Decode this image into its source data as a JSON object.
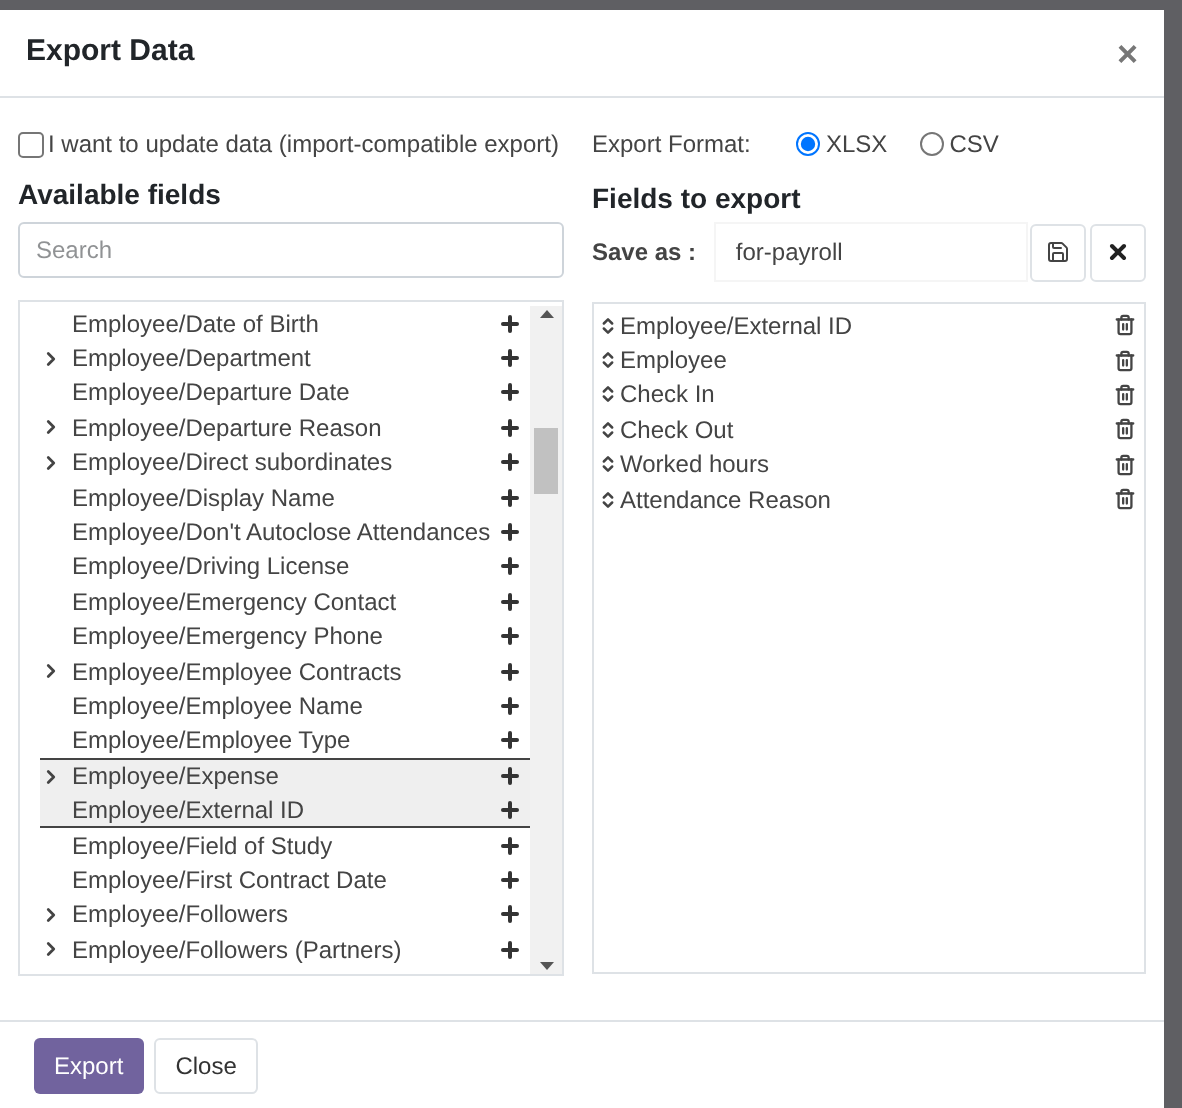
{
  "dialog": {
    "title": "Export Data",
    "close": "×"
  },
  "import_compatible": {
    "label": "I want to update data (import-compatible export)",
    "checked": false
  },
  "export_format": {
    "label": "Export Format:",
    "options": [
      {
        "label": "XLSX",
        "selected": true
      },
      {
        "label": "CSV",
        "selected": false
      }
    ]
  },
  "available_fields": {
    "title": "Available fields",
    "search": {
      "placeholder": "Search"
    },
    "items": [
      {
        "label": "Employee/Date of Birth",
        "expandable": false,
        "selected": false
      },
      {
        "label": "Employee/Department",
        "expandable": true,
        "selected": false
      },
      {
        "label": "Employee/Departure Date",
        "expandable": false,
        "selected": false
      },
      {
        "label": "Employee/Departure Reason",
        "expandable": true,
        "selected": false
      },
      {
        "label": "Employee/Direct subordinates",
        "expandable": true,
        "selected": false
      },
      {
        "label": "Employee/Display Name",
        "expandable": false,
        "selected": false
      },
      {
        "label": "Employee/Don't Autoclose Attendances",
        "expandable": false,
        "selected": false
      },
      {
        "label": "Employee/Driving License",
        "expandable": false,
        "selected": false
      },
      {
        "label": "Employee/Emergency Contact",
        "expandable": false,
        "selected": false
      },
      {
        "label": "Employee/Emergency Phone",
        "expandable": false,
        "selected": false
      },
      {
        "label": "Employee/Employee Contracts",
        "expandable": true,
        "selected": false
      },
      {
        "label": "Employee/Employee Name",
        "expandable": false,
        "selected": false
      },
      {
        "label": "Employee/Employee Type",
        "expandable": false,
        "selected": false
      },
      {
        "label": "Employee/Expense",
        "expandable": true,
        "selected": true
      },
      {
        "label": "Employee/External ID",
        "expandable": false,
        "selected": true
      },
      {
        "label": "Employee/Field of Study",
        "expandable": false,
        "selected": false
      },
      {
        "label": "Employee/First Contract Date",
        "expandable": false,
        "selected": false
      },
      {
        "label": "Employee/Followers",
        "expandable": true,
        "selected": false
      },
      {
        "label": "Employee/Followers (Partners)",
        "expandable": true,
        "selected": false
      }
    ]
  },
  "fields_to_export": {
    "title": "Fields to export",
    "save_as": {
      "label": "Save as :",
      "value": "for-payroll"
    },
    "items": [
      "Employee/External ID",
      "Employee",
      "Check In",
      "Check Out",
      "Worked hours",
      "Attendance Reason"
    ]
  },
  "footer": {
    "buttons": [
      {
        "label": "Export",
        "primary": true
      },
      {
        "label": "Close",
        "primary": false
      }
    ]
  }
}
